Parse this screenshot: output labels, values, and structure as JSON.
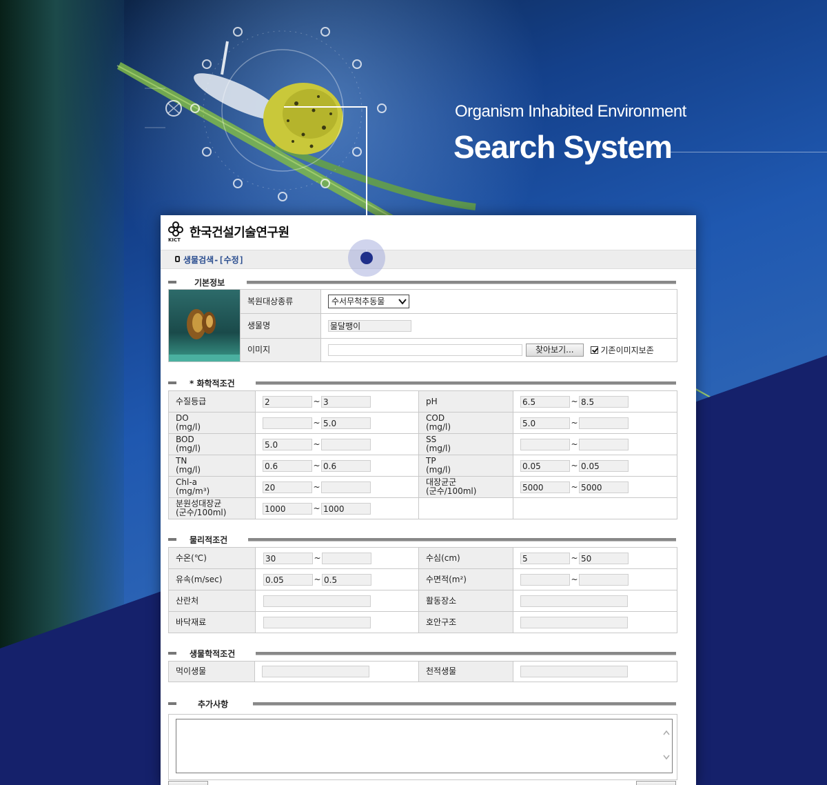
{
  "hero": {
    "subtitle": "Organism Inhabited Environment",
    "title": "Search System"
  },
  "app": {
    "org_name": "한국건설기술연구원",
    "logo_text": "KICT",
    "breadcrumb": "생물검색-[수정]"
  },
  "basic": {
    "section": "기본정보",
    "rows": [
      {
        "label": "복원대상종류",
        "value": "수서무척추동물"
      },
      {
        "label": "생물명",
        "value": "물달팽이"
      },
      {
        "label": "이미지",
        "value": ""
      }
    ],
    "browse_button": "찾아보기...",
    "keep_image_label": "기존이미지보존",
    "keep_image_checked": true
  },
  "chemical": {
    "section": "* 화학적조건",
    "rows": [
      {
        "l_label": "수질등급",
        "l_min": "2",
        "l_max": "3",
        "r_label": "pH",
        "r_min": "6.5",
        "r_max": "8.5"
      },
      {
        "l_label": "DO\n(mg/l)",
        "l_min": "",
        "l_max": "5.0",
        "r_label": "COD\n(mg/l)",
        "r_min": "5.0",
        "r_max": ""
      },
      {
        "l_label": "BOD\n(mg/l)",
        "l_min": "5.0",
        "l_max": "",
        "r_label": "SS\n(mg/l)",
        "r_min": "",
        "r_max": ""
      },
      {
        "l_label": "TN\n(mg/l)",
        "l_min": "0.6",
        "l_max": "0.6",
        "r_label": "TP\n(mg/l)",
        "r_min": "0.05",
        "r_max": "0.05"
      },
      {
        "l_label": "Chl-a\n(mg/m³)",
        "l_min": "20",
        "l_max": "",
        "r_label": "대장균군\n(군수/100ml)",
        "r_min": "5000",
        "r_max": "5000"
      },
      {
        "l_label": "분원성대장균\n(군수/100ml)",
        "l_min": "1000",
        "l_max": "1000",
        "r_label": "",
        "r_min": null,
        "r_max": null
      }
    ]
  },
  "physical": {
    "section": "물리적조건",
    "rows": [
      {
        "l_label": "수온(℃)",
        "l_min": "30",
        "l_max": "",
        "r_label": "수심(cm)",
        "r_min": "5",
        "r_max": "50"
      },
      {
        "l_label": "유속(m/sec)",
        "l_min": "0.05",
        "l_max": "0.5",
        "r_label": "수면적(m²)",
        "r_min": "",
        "r_max": ""
      },
      {
        "l_label": "산란처",
        "l_value": "",
        "r_label": "활동장소",
        "r_value": ""
      },
      {
        "l_label": "바닥재료",
        "l_value": "",
        "r_label": "호안구조",
        "r_value": ""
      }
    ]
  },
  "biological": {
    "section": "생물학적조건",
    "rows": [
      {
        "l_label": "먹이생물",
        "l_value": "",
        "r_label": "천적생물",
        "r_value": ""
      }
    ]
  },
  "extra": {
    "section": "추가사항",
    "value": ""
  },
  "colors": {
    "navy": "#15216b",
    "pin": "#1f2f8a",
    "link": "#2a4d8f"
  }
}
